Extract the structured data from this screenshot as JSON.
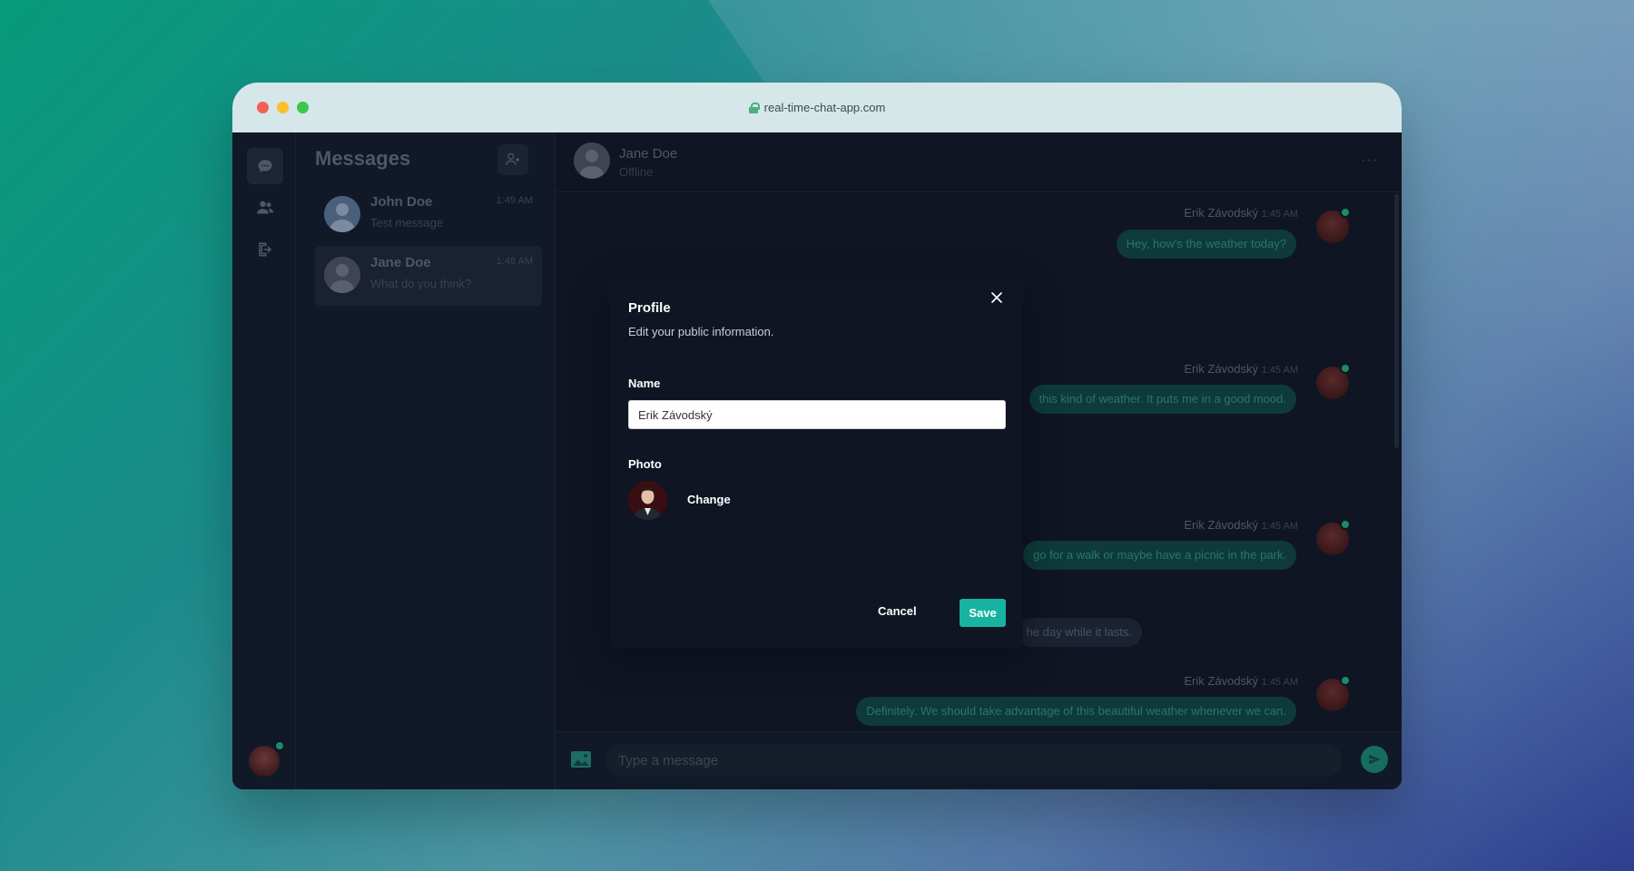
{
  "browser": {
    "url": "real-time-chat-app.com",
    "dots": [
      "#f25f58",
      "#fbbe2e",
      "#39c84a"
    ]
  },
  "rail": {
    "items": [
      "chat-bubble-icon",
      "users-icon",
      "logout-icon"
    ]
  },
  "sidebar": {
    "title": "Messages",
    "conversations": [
      {
        "name": "John Doe",
        "time": "1:49 AM",
        "preview": "Test message"
      },
      {
        "name": "Jane Doe",
        "time": "1:48 AM",
        "preview": "What do you think?"
      }
    ]
  },
  "chat": {
    "contact_name": "Jane Doe",
    "contact_status": "Offline",
    "more_icon": "ellipsis-icon",
    "messages": [
      {
        "author": "Erik Závodský",
        "time": "1:45 AM",
        "text": "Hey, how's the weather today?"
      },
      {
        "author": "Erik Závodský",
        "time": "1:45 AM",
        "text": "this kind of weather. It puts me in a good mood."
      },
      {
        "author": "Erik Závodský",
        "time": "1:45 AM",
        "text": "go for a walk or maybe have a picnic in the park."
      },
      {
        "author": "",
        "time": "",
        "text": "he day while it lasts."
      },
      {
        "author": "Erik Závodský",
        "time": "1:45 AM",
        "text": "Definitely. We should take advantage of this beautiful weather whenever we can."
      }
    ],
    "composer_placeholder": "Type a message"
  },
  "modal": {
    "title": "Profile",
    "subtitle": "Edit your public information.",
    "name_label": "Name",
    "name_value": "Erik Závodský",
    "photo_label": "Photo",
    "change_label": "Change",
    "cancel_label": "Cancel",
    "save_label": "Save",
    "accent": "#17b3a0"
  }
}
